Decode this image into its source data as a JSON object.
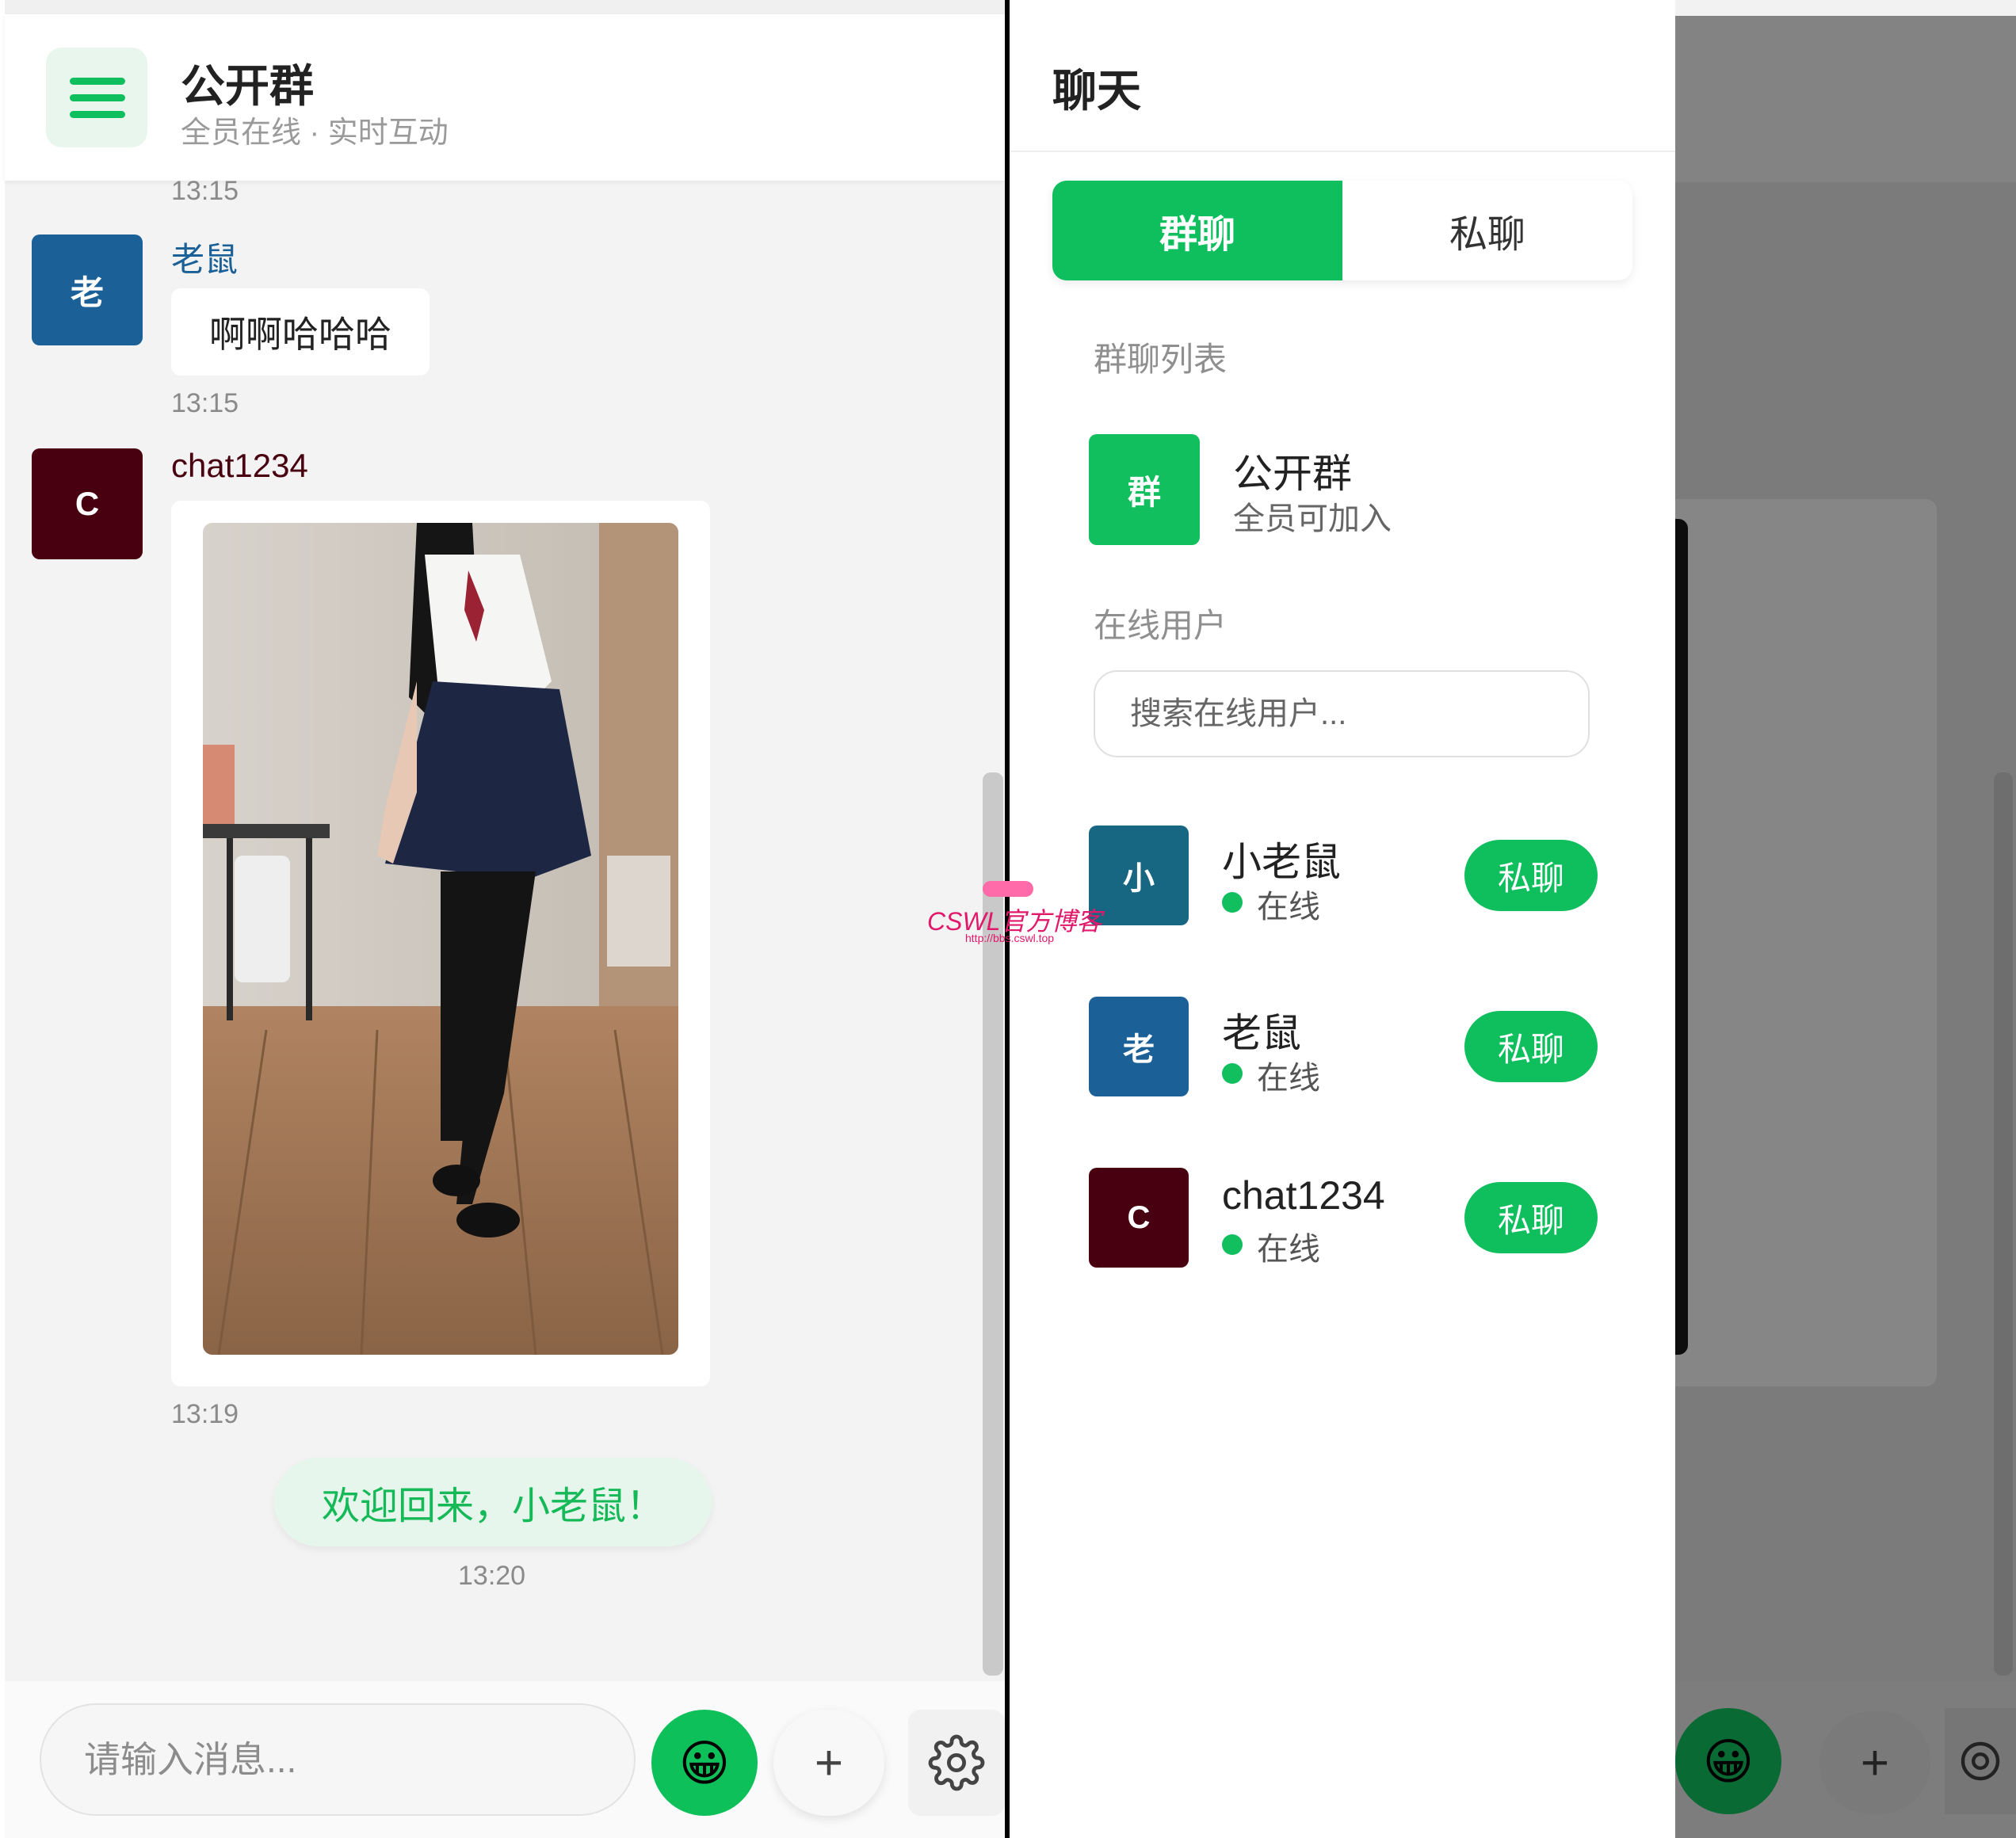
{
  "left": {
    "header": {
      "title": "公开群",
      "subtitle": "全员在线 · 实时互动",
      "menu_icon": "hamburger-menu-icon"
    },
    "messages": [
      {
        "type": "timestamp",
        "time": "13:15"
      },
      {
        "type": "text",
        "sender": "老鼠",
        "avatar_letter": "老",
        "avatar_color": "#1b6096",
        "name_color": "#1b6096",
        "text": "啊啊哈哈哈",
        "time": "13:15"
      },
      {
        "type": "image",
        "sender": "chat1234",
        "avatar_letter": "C",
        "avatar_color": "#480010",
        "name_color": "#480010",
        "time": "13:19"
      },
      {
        "type": "system",
        "text": "欢迎回来，小老鼠！",
        "time": "13:20"
      }
    ],
    "input": {
      "placeholder": "请输入消息..."
    },
    "buttons": {
      "emoji": "😀",
      "plus": "+",
      "settings_icon": "gear-icon"
    }
  },
  "drawer": {
    "title": "聊天",
    "tabs": [
      {
        "label": "群聊",
        "active": true
      },
      {
        "label": "私聊",
        "active": false
      }
    ],
    "group_section_label": "群聊列表",
    "groups": [
      {
        "icon_label": "群",
        "name": "公开群",
        "desc": "全员可加入"
      }
    ],
    "online_section_label": "在线用户",
    "search_placeholder": "搜索在线用户...",
    "users": [
      {
        "avatar_letter": "小",
        "avatar_color": "#176682",
        "name": "小老鼠",
        "status": "在线",
        "action": "私聊"
      },
      {
        "avatar_letter": "老",
        "avatar_color": "#1b6096",
        "name": "老鼠",
        "status": "在线",
        "action": "私聊"
      },
      {
        "avatar_letter": "C",
        "avatar_color": "#480010",
        "name": "chat1234",
        "status": "在线",
        "action": "私聊"
      }
    ]
  },
  "watermark": {
    "brand": "CSWL官方博客",
    "url": "http://bbs.cswl.top"
  },
  "colors": {
    "accent": "#0fbf5e",
    "overlay": "#7b7b7b"
  }
}
